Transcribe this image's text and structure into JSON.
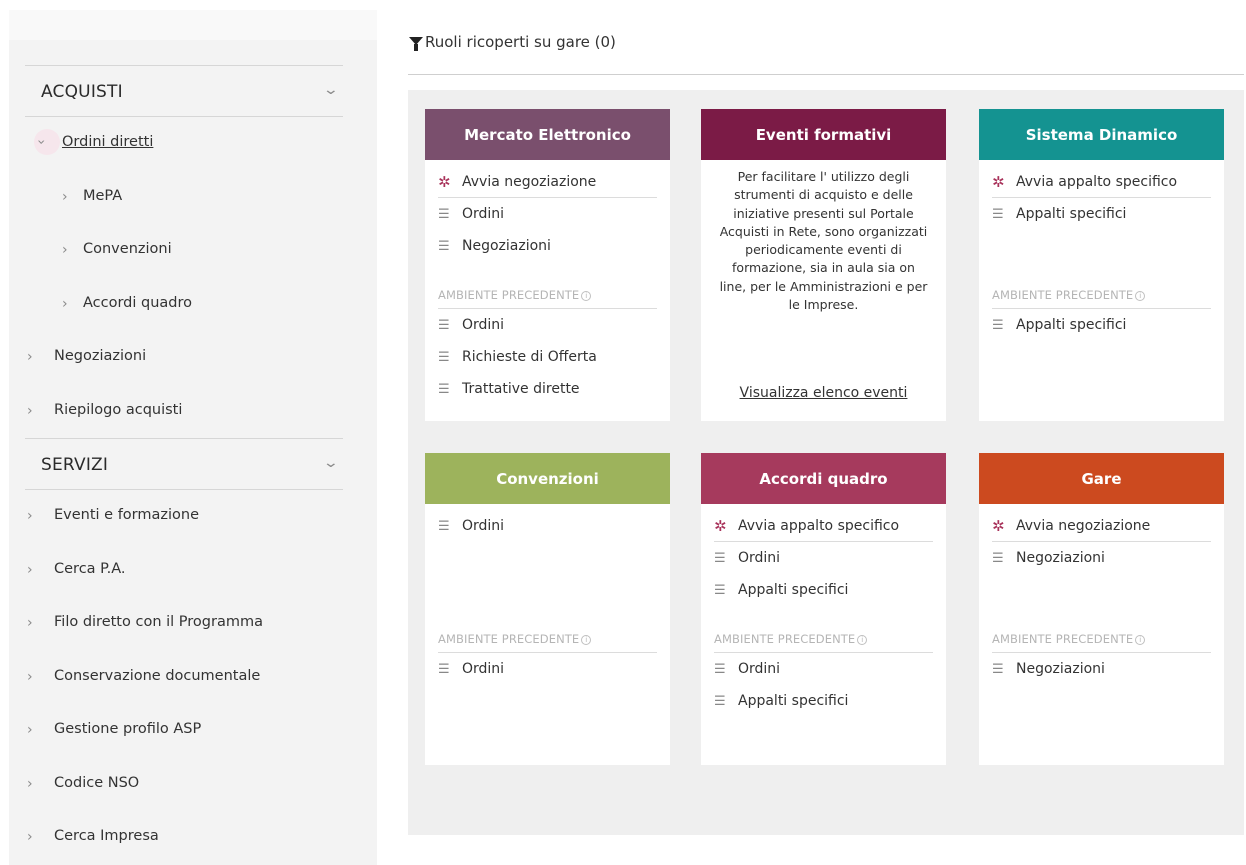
{
  "sidebar": {
    "sections": [
      {
        "title": "ACQUISTI",
        "items": [
          {
            "label": "Ordini diretti",
            "level": 1,
            "open": true
          },
          {
            "label": "MePA",
            "level": 2
          },
          {
            "label": "Convenzioni",
            "level": 2
          },
          {
            "label": "Accordi quadro",
            "level": 2
          },
          {
            "label": "Negoziazioni",
            "level": 0
          },
          {
            "label": "Riepilogo acquisti",
            "level": 0
          }
        ]
      },
      {
        "title": "SERVIZI",
        "items": [
          {
            "label": "Eventi e formazione",
            "level": 0
          },
          {
            "label": "Cerca P.A.",
            "level": 0
          },
          {
            "label": "Filo diretto con il Programma",
            "level": 0
          },
          {
            "label": "Conservazione documentale",
            "level": 0
          },
          {
            "label": "Gestione profilo ASP",
            "level": 0
          },
          {
            "label": "Codice NSO",
            "level": 0
          },
          {
            "label": "Cerca Impresa",
            "level": 0
          }
        ]
      }
    ]
  },
  "filter": {
    "label": "Ruoli ricoperti su gare (0)"
  },
  "cards": {
    "mercato": {
      "title": "Mercato Elettronico",
      "color": "#7a4f6d",
      "items": [
        "Avvia negoziazione",
        "Ordini",
        "Negoziazioni"
      ],
      "prev_label": "AMBIENTE PRECEDENTE",
      "prev_items": [
        "Ordini",
        "Richieste di Offerta",
        "Trattative dirette"
      ]
    },
    "eventi": {
      "title": "Eventi formativi",
      "color": "#7b1b46",
      "description": "Per facilitare l' utilizzo degli strumenti di acquisto e delle iniziative presenti sul Portale Acquisti in Rete, sono organizzati periodicamente eventi di formazione, sia in aula sia on line, per le Amministrazioni e per le Imprese.",
      "link": "Visualizza elenco eventi"
    },
    "sistema": {
      "title": "Sistema Dinamico",
      "color": "#149391",
      "items": [
        "Avvia appalto specifico",
        "Appalti specifici"
      ],
      "prev_label": "AMBIENTE PRECEDENTE",
      "prev_items": [
        "Appalti specifici"
      ]
    },
    "convenzioni": {
      "title": "Convenzioni",
      "color": "#9db35c",
      "items": [
        "Ordini"
      ],
      "prev_label": "AMBIENTE PRECEDENTE",
      "prev_items": [
        "Ordini"
      ]
    },
    "accordi": {
      "title": "Accordi quadro",
      "color": "#a63a5d",
      "items": [
        "Avvia appalto specifico",
        "Ordini",
        "Appalti specifici"
      ],
      "prev_label": "AMBIENTE PRECEDENTE",
      "prev_items": [
        "Ordini",
        "Appalti specifici"
      ]
    },
    "gare": {
      "title": "Gare",
      "color": "#cc4a1f",
      "items": [
        "Avvia negoziazione",
        "Negoziazioni"
      ],
      "prev_label": "AMBIENTE PRECEDENTE",
      "prev_items": [
        "Negoziazioni"
      ]
    }
  }
}
